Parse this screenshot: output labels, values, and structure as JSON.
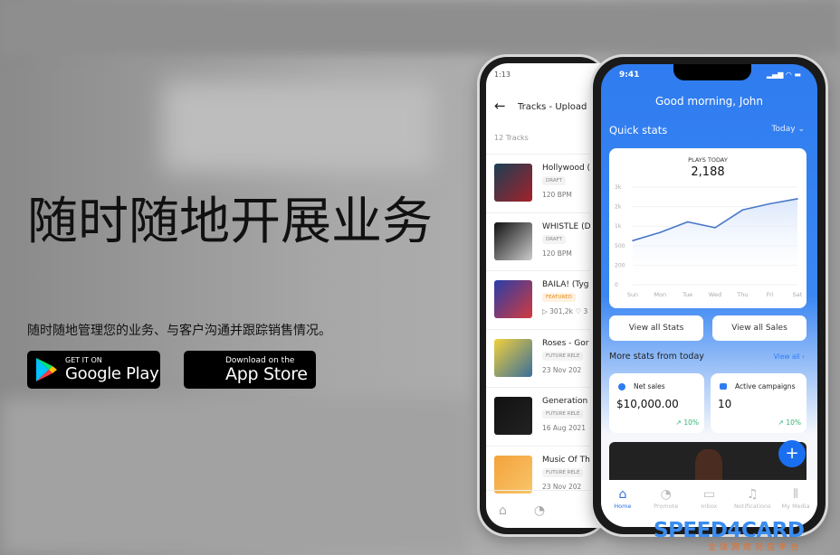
{
  "hero": {
    "title": "随时随地开展业务",
    "subtitle": "随时随地管理您的业务、与客户沟通并跟踪销售情况。"
  },
  "store_badges": {
    "google": {
      "small": "GET IT ON",
      "big": "Google Play"
    },
    "apple": {
      "small": "Download on the",
      "big": "App Store"
    }
  },
  "back_phone": {
    "time": "1:13",
    "title": "Tracks - Upload",
    "count": "12 Tracks",
    "tracks": [
      {
        "title": "Hollywood (",
        "tag": "DRAFT",
        "meta": "120 BPM",
        "colors": [
          "#1b3f55",
          "#a3212a"
        ]
      },
      {
        "title": "WHISTLE (D",
        "tag": "DRAFT",
        "meta": "120 BPM",
        "colors": [
          "#111",
          "#ccc"
        ]
      },
      {
        "title": "BAILA! (Tyg",
        "tag": "FEATURED",
        "meta": "▷ 301,2k  ♡ 3",
        "colors": [
          "#2a3ea8",
          "#d23a3e"
        ]
      },
      {
        "title": "Roses - Gor",
        "tag": "FUTURE RELE",
        "meta": "23 Nov 202",
        "colors": [
          "#f1d03d",
          "#3a6e9a"
        ]
      },
      {
        "title": "Generation",
        "tag": "FUTURE RELE",
        "meta": "16 Aug 2021",
        "colors": [
          "#111",
          "#222"
        ]
      },
      {
        "title": "Music Of Th",
        "tag": "FUTURE RELE",
        "meta": "23 Nov 202",
        "colors": [
          "#f4a23a",
          "#f8c56a"
        ]
      }
    ]
  },
  "front_phone": {
    "time": "9:41",
    "greeting": "Good morning, John",
    "quick_stats": "Quick stats",
    "period": "Today",
    "plays_label": "PLAYS TODAY",
    "plays_value": "2,188",
    "view_stats": "View all Stats",
    "view_sales": "View all Sales",
    "more_stats": "More stats from today",
    "view_all": "View all",
    "net_sales": {
      "label": "Net sales",
      "value": "$10,000.00",
      "change": "↗ 10%"
    },
    "campaigns": {
      "label": "Active campaigns",
      "value": "10",
      "change": "↗ 10%"
    },
    "nav": [
      {
        "label": "Home",
        "icon": "home-icon"
      },
      {
        "label": "Promote",
        "icon": "promote-icon"
      },
      {
        "label": "Inbox",
        "icon": "inbox-icon"
      },
      {
        "label": "Notifications",
        "icon": "bell-icon"
      },
      {
        "label": "My Media",
        "icon": "media-icon"
      }
    ],
    "accent": "#2f7cf0"
  },
  "chart_data": {
    "type": "area",
    "title": "PLAYS TODAY",
    "categories": [
      "Sun",
      "Mon",
      "Tue",
      "Wed",
      "Thu",
      "Fri",
      "Sat"
    ],
    "values": [
      630,
      840,
      1220,
      960,
      1830,
      2150,
      2400
    ],
    "yticks": [
      "0",
      "200",
      "500",
      "1k",
      "2k",
      "3k"
    ],
    "ytick_values": [
      0,
      200,
      500,
      1000,
      2000,
      3000
    ]
  },
  "watermark": {
    "brand": "SPEED4CARD",
    "tagline": "全球跨境充值平台"
  }
}
